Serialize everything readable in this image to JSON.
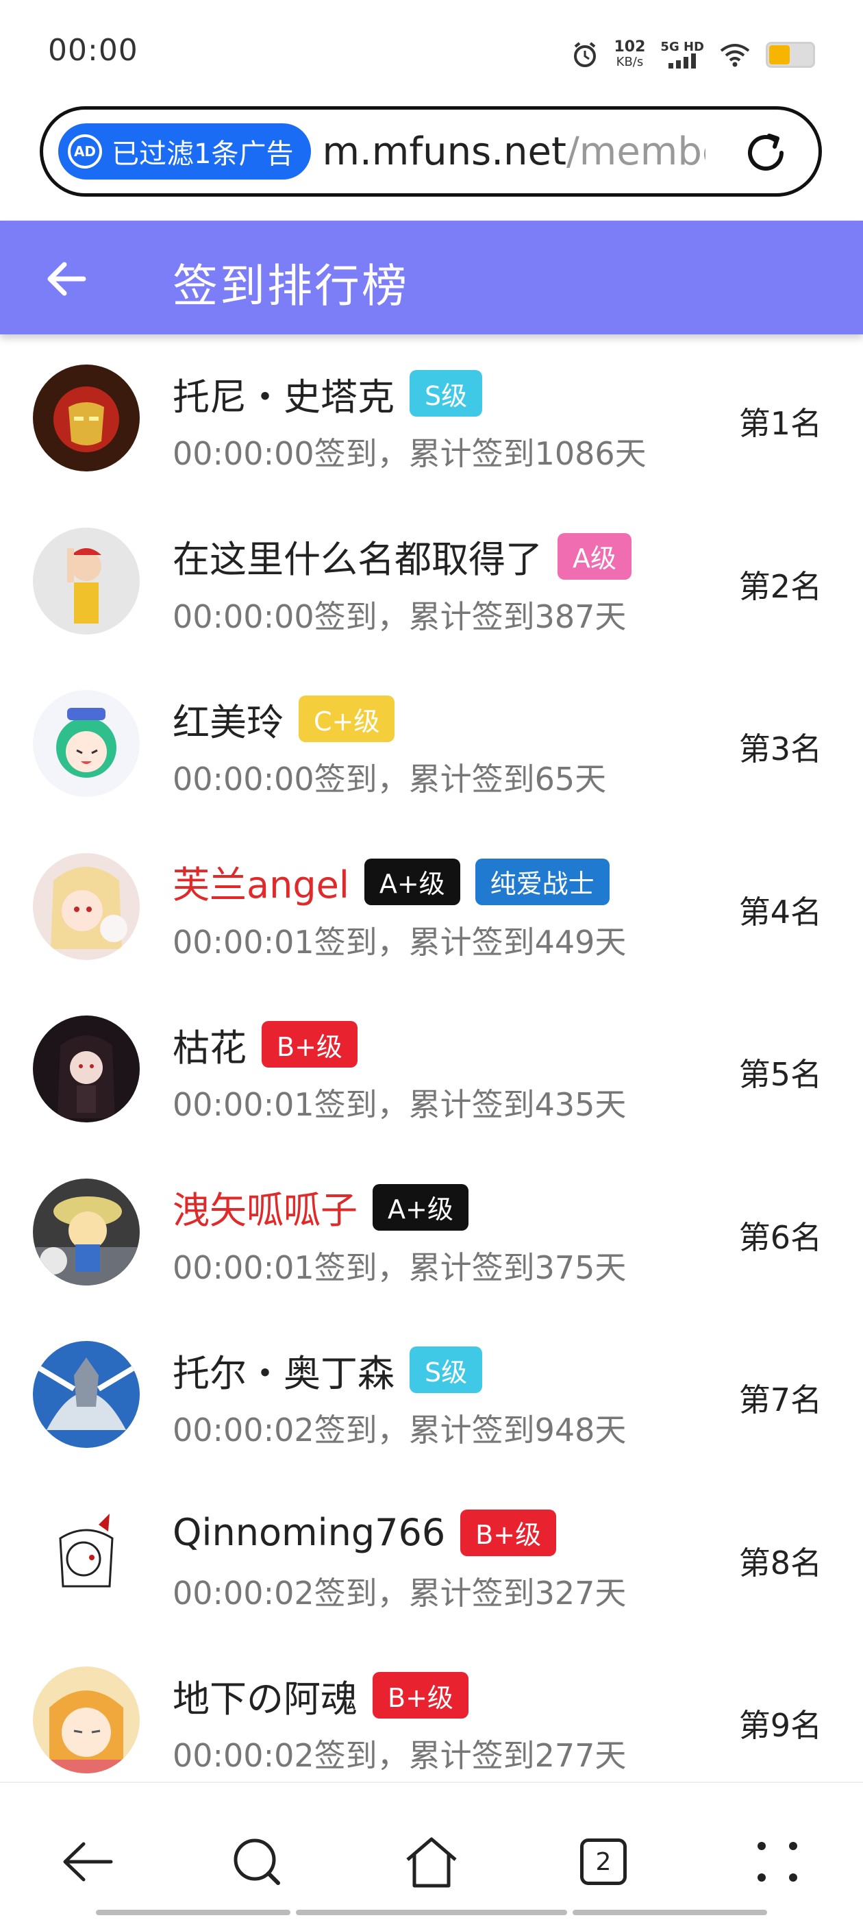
{
  "status_bar": {
    "time": "00:00",
    "net_speed_value": "102",
    "net_speed_unit": "KB/s",
    "network": "5G HD",
    "battery_level": 0.45
  },
  "url_bar": {
    "ad_badge": "已过滤1条广告",
    "ad_icon": "AD",
    "host": "m.mfuns.net",
    "path": "/membe"
  },
  "header": {
    "title": "签到排行榜"
  },
  "colors": {
    "header_bg": "#7b7ef6",
    "badge_s": "#3fc9e6",
    "badge_a": "#f06db2",
    "badge_c_plus": "#f5cf3b",
    "badge_a_plus": "#111111",
    "badge_b_plus": "#e8222f",
    "badge_title": "#1f7ad0",
    "name_red": "#e02a2a",
    "ad_badge_bg": "#1a6cf5"
  },
  "ranking": [
    {
      "name": "托尼・史塔克",
      "name_color": "normal",
      "badges": [
        {
          "text": "S级",
          "color": "#3fc9e6"
        }
      ],
      "detail": "00:00:00签到，累计签到1086天",
      "rank": "第1名",
      "avatar": "iron-man-avatar"
    },
    {
      "name": "在这里什么名都取得了",
      "name_color": "normal",
      "badges": [
        {
          "text": "A级",
          "color": "#f06db2"
        }
      ],
      "detail": "00:00:00签到，累计签到387天",
      "rank": "第2名",
      "avatar": "clown-avatar"
    },
    {
      "name": "红美玲",
      "name_color": "normal",
      "badges": [
        {
          "text": "C+级",
          "color": "#f5cf3b"
        }
      ],
      "detail": "00:00:00签到，累计签到65天",
      "rank": "第3名",
      "avatar": "green-hair-avatar"
    },
    {
      "name": "芙兰angel",
      "name_color": "red",
      "badges": [
        {
          "text": "A+级",
          "color": "#111111"
        },
        {
          "text": "纯爱战士",
          "color": "#1f7ad0"
        }
      ],
      "detail": "00:00:01签到，累计签到449天",
      "rank": "第4名",
      "avatar": "blonde-girl-avatar"
    },
    {
      "name": "枯花",
      "name_color": "normal",
      "badges": [
        {
          "text": "B+级",
          "color": "#e8222f"
        }
      ],
      "detail": "00:00:01签到，累计签到435天",
      "rank": "第5名",
      "avatar": "dark-girl-avatar"
    },
    {
      "name": "洩矢呱呱子",
      "name_color": "red",
      "badges": [
        {
          "text": "A+级",
          "color": "#111111"
        }
      ],
      "detail": "00:00:01签到，累计签到375天",
      "rank": "第6名",
      "avatar": "plush-doll-avatar"
    },
    {
      "name": "托尔・奥丁森",
      "name_color": "normal",
      "badges": [
        {
          "text": "S级",
          "color": "#3fc9e6"
        }
      ],
      "detail": "00:00:02签到，累计签到948天",
      "rank": "第7名",
      "avatar": "silver-warrior-avatar"
    },
    {
      "name": "Qinnoming766",
      "name_color": "normal",
      "badges": [
        {
          "text": "B+级",
          "color": "#e8222f"
        }
      ],
      "detail": "00:00:02签到，累计签到327天",
      "rank": "第8名",
      "avatar": "sketch-girl-avatar"
    },
    {
      "name": "地下の阿魂",
      "name_color": "normal",
      "badges": [
        {
          "text": "B+级",
          "color": "#e8222f"
        }
      ],
      "detail": "00:00:02签到，累计签到277天",
      "rank": "第9名",
      "avatar": "orange-hair-avatar"
    }
  ],
  "bottom_nav": {
    "tab_count": "2",
    "icons": [
      "back-icon",
      "search-icon",
      "home-icon",
      "tabs-icon",
      "menu-icon"
    ]
  }
}
